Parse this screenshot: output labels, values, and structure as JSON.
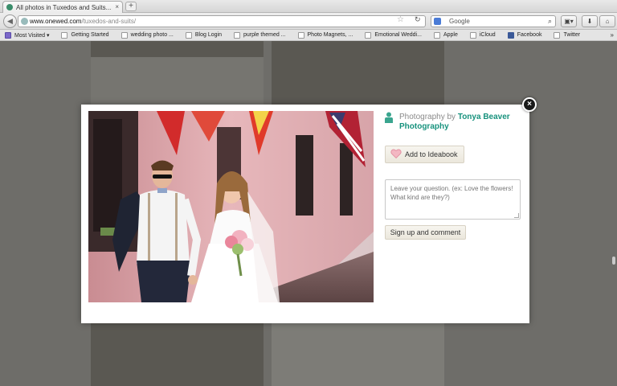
{
  "browser": {
    "tab_title": "All photos in Tuxedos and Suits...",
    "tab_close": "×",
    "new_tab": "+",
    "back": "◀",
    "url_host": "www.onewed.com",
    "url_path": "/tuxedos-and-suits/",
    "search_engine": "Google",
    "search_placeholder": "Google",
    "bookmarks": [
      {
        "label": "Most Visited ▾",
        "icon": "most-visited-icon"
      },
      {
        "label": "Getting Started",
        "icon": "page-icon"
      },
      {
        "label": "wedding photo ...",
        "icon": "page-icon"
      },
      {
        "label": "Blog Login",
        "icon": "page-icon"
      },
      {
        "label": "purple themed ...",
        "icon": "page-icon"
      },
      {
        "label": "Photo Magnets, ...",
        "icon": "page-icon"
      },
      {
        "label": "Emotional Weddi...",
        "icon": "page-icon"
      },
      {
        "label": "Apple",
        "icon": "apple-icon"
      },
      {
        "label": "iCloud",
        "icon": "page-icon"
      },
      {
        "label": "Facebook",
        "icon": "facebook-icon"
      },
      {
        "label": "Twitter",
        "icon": "page-icon"
      }
    ],
    "bookmarks_overflow": "»"
  },
  "modal": {
    "close": "×",
    "credit_prefix": "Photography by ",
    "photographer": "Tonya Beaver Photography",
    "ideabook_label": "Add to Ideabook",
    "question_placeholder": "Leave your question. (ex: Love the flowers! What kind are they?)",
    "signup_label": "Sign up and comment"
  },
  "colors": {
    "accent": "#17927d",
    "overlay": "#6e6d69"
  }
}
